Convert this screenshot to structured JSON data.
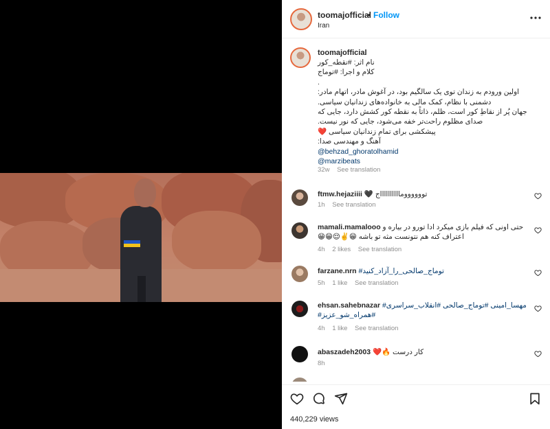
{
  "post": {
    "username": "toomajofficial",
    "dot": "•",
    "follow_label": "Follow",
    "location": "Iran"
  },
  "caption": {
    "username": "toomajofficial",
    "userdot": ".",
    "lines": [
      "نام اثر: #نقطه_کور",
      "کلام و اجرا: #توماج",
      ".",
      "اولین ورودم به زندان توی یک سالگیم بود، در آغوش مادر، اتهام مادر:",
      "دشمنی با نظام، کمک مالی به خانواده‌های زندانیان سیاسی.",
      "جهان پُر از نقاطِ کور است، ظلم، ذاتاً به نقطه کور کشش دارد، جایی که",
      "صدای مظلوم راحت‌تر خفه می‌شود، جایی که نور نیست.",
      "پیشکشی برای تمام زندانیان سیاسی ❤️",
      "آهنگ و مهندسی صدا:"
    ],
    "mentions": [
      "@behzad_ghoratolhamid",
      "@marzibeats"
    ],
    "time": "32w",
    "see_translation": "See translation"
  },
  "comments": [
    {
      "username": "ftmw.hejaziiii",
      "text": "توووووومااااااااااج 🖤",
      "time": "1h",
      "likes": "",
      "see_translation": "See translation"
    },
    {
      "username": "mamali.mamalooo",
      "text": "حتی اونی که فیلم بازی میکرد ادا تورو در بیاره و اعتراف کنه هم نتونست مثه تو باشه 😁✌️😌😁😁",
      "time": "4h",
      "likes": "2 likes",
      "see_translation": "See translation"
    },
    {
      "username": "farzane.nrn",
      "text": "توماج_صالحی_را_آزاد_کنید#",
      "time": "5h",
      "likes": "1 like",
      "see_translation": "See translation"
    },
    {
      "username": "ehsan.sahebnazar",
      "text": "مهسا_امینی #توماج_صالحی #انقلاب_سراسری# #همراه_شو_عزیز#",
      "time": "4h",
      "likes": "1 like",
      "see_translation": "See translation"
    },
    {
      "username": "abaszadeh2003",
      "text": "کار درست 🔥❤️",
      "time": "8h",
      "likes": "",
      "see_translation": ""
    }
  ],
  "actions": {
    "views": "440,229 views"
  },
  "icons": {
    "more": "more-horizontal-icon",
    "heart": "heart-icon",
    "comment": "comment-icon",
    "share": "share-icon",
    "save": "bookmark-icon"
  },
  "colors": {
    "follow": "#0095f6",
    "hashtag": "#00376b",
    "meta": "#8e8e8e",
    "flag_blue": "#1e56c4",
    "flag_yellow": "#f1c21b"
  }
}
